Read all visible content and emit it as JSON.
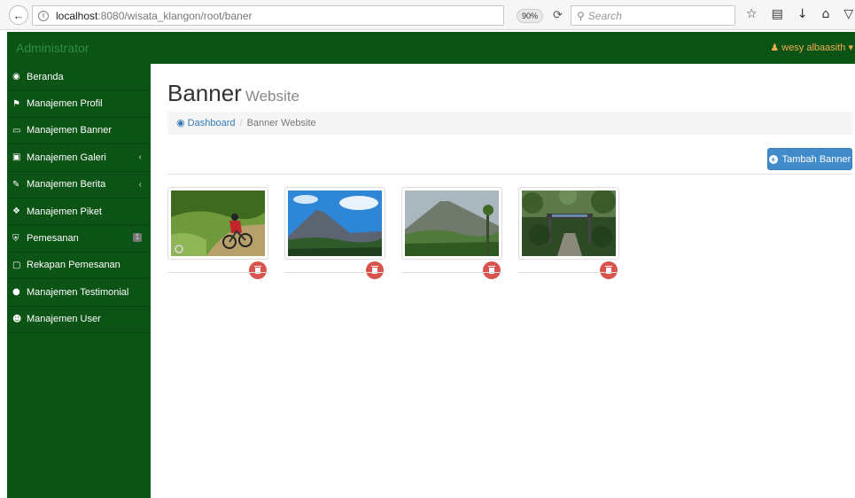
{
  "browser": {
    "url_host": "localhost",
    "url_path": ":8080/wisata_klangon/root/baner",
    "zoom": "90%",
    "search_placeholder": "Search",
    "icons": [
      "back-icon",
      "info-icon",
      "reload-icon",
      "search-icon",
      "star-icon",
      "clipboard-icon",
      "download-icon",
      "home-icon",
      "pocket-icon"
    ]
  },
  "navbar": {
    "brand": "Administrator",
    "user_name": "wesy albaasith",
    "user_caret": "▾"
  },
  "sidebar": {
    "items": [
      {
        "label": "Beranda",
        "icon": "dashboard-icon"
      },
      {
        "label": "Manajemen Profil",
        "icon": "flag-icon"
      },
      {
        "label": "Manajemen Banner",
        "icon": "desktop-icon"
      },
      {
        "label": "Manajemen Galeri",
        "icon": "picture-icon",
        "arrow": "‹"
      },
      {
        "label": "Manajemen Berita",
        "icon": "pencil-icon",
        "arrow": "‹"
      },
      {
        "label": "Manajemen Piket",
        "icon": "cubes-icon"
      },
      {
        "label": "Pemesanan",
        "icon": "cart-icon",
        "badge": "1"
      },
      {
        "label": "Rekapan Pemesanan",
        "icon": "file-icon"
      },
      {
        "label": "Manajemen Testimonial",
        "icon": "comments-icon"
      },
      {
        "label": "Manajemen User",
        "icon": "users-icon"
      }
    ]
  },
  "header": {
    "title": "Banner",
    "subtitle": "Website"
  },
  "breadcrumb": {
    "home": "Dashboard",
    "current": "Banner Website"
  },
  "actions": {
    "add_label": "Tambah Banner"
  },
  "banners": [
    {
      "image": "mountain-biker-photo"
    },
    {
      "image": "volcano-blue-sky-photo"
    },
    {
      "image": "volcano-forest-photo"
    },
    {
      "image": "forest-gate-photo"
    }
  ],
  "colors": {
    "sidebar_bg": "#0c5316",
    "primary_button": "#428bca",
    "delete_button": "#d9534f",
    "user_name": "#f0ad4e"
  }
}
